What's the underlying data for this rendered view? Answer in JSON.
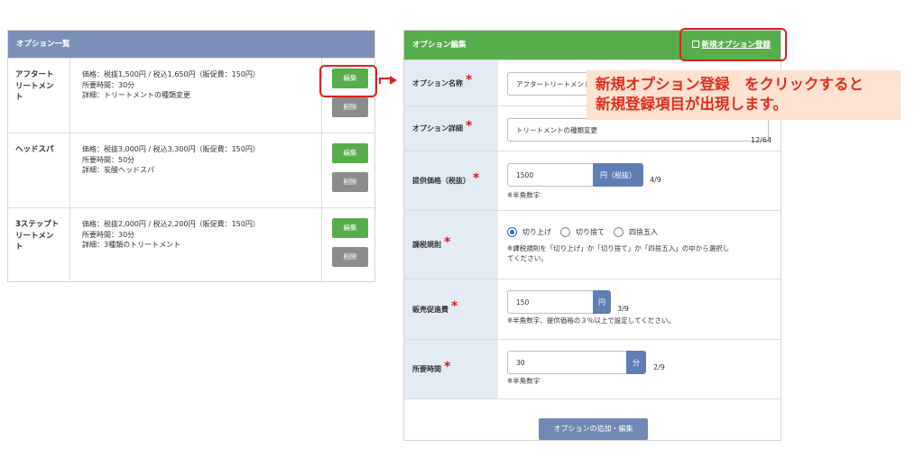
{
  "list": {
    "title": "オプション一覧",
    "edit_label": "編集",
    "delete_label": "削除",
    "items": [
      {
        "name": "アフタートリートメント",
        "name_lines": [
          "アフタート",
          "リートメン",
          "ト"
        ],
        "price": "価格：税抜1,500円 / 税込1,650円（販促費：150円）",
        "time": "所要時間：30分",
        "detail": "詳細：トリートメントの種類変更"
      },
      {
        "name": "ヘッドスパ",
        "name_lines": [
          "ヘッドスパ"
        ],
        "price": "価格：税抜3,000円 / 税込3,300円（販促費：150円）",
        "time": "所要時間：50分",
        "detail": "詳細：炭酸ヘッドスパ"
      },
      {
        "name": "3ステップトリートメント",
        "name_lines": [
          "3ステップト",
          "リートメン",
          "ト"
        ],
        "price": "価格：税抜2,000円 / 税込2,200円（販促費：150円）",
        "time": "所要時間：30分",
        "detail": "詳細：3種類のトリートメント"
      }
    ]
  },
  "form": {
    "title": "オプション編集",
    "new_link": "新規オプション登録",
    "fields": {
      "name": {
        "label": "オプション名称",
        "value": "アフタートリートメント"
      },
      "detail": {
        "label": "オプション詳細",
        "value": "トリートメントの種類変更",
        "count": "12/64"
      },
      "price": {
        "label": "提供価格（税抜）",
        "value": "1500",
        "unit": "円（税抜）",
        "count": "4/9",
        "hint": "※半角数字"
      },
      "tax_rule": {
        "label": "課税規則",
        "options": [
          "切り上げ",
          "切り捨て",
          "四捨五入"
        ],
        "selected": "切り上げ",
        "hint_line1": "※課税規則を「切り上げ」か「切り捨て」か「四捨五入」の中から選択し",
        "hint_line2": "てください。"
      },
      "promo": {
        "label": "販売促進費",
        "value": "150",
        "unit": "円",
        "count": "3/9",
        "hint": "※半角数字、提供価格の３％以上で設定してください。"
      },
      "duration": {
        "label": "所要時間",
        "value": "30",
        "unit": "分",
        "count": "2/9",
        "hint": "※半角数字"
      }
    },
    "submit_label": "オプションの追加・編集"
  },
  "callout": {
    "line1": "新規オプション登録　をクリックすると",
    "line2": "新規登録項目が出現します。"
  },
  "colors": {
    "list_header": "#7b8fb8",
    "form_header": "#57ad4b",
    "edit_button": "#57ad4b",
    "delete_button": "#8c8c8c",
    "unit_badge": "#5f7eb3",
    "label_bg": "#e3ebf5",
    "highlight": "#e02020",
    "callout_bg": "#fde1d1",
    "callout_text": "#e0301e"
  }
}
